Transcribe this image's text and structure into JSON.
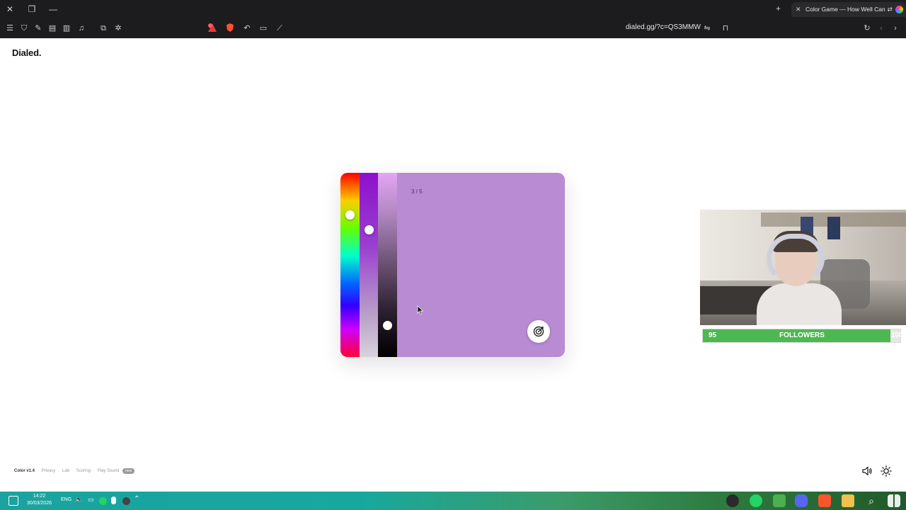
{
  "browser": {
    "tab_title": "Color Game — How Well Can",
    "url": "dialed.gg/?c=QS3MMW"
  },
  "page": {
    "logo": "Dialed."
  },
  "game": {
    "counter": "3 / 5",
    "target_color": "#b98bd3",
    "hue_level": 0.77,
    "saturation_level": 0.69,
    "lightness_level": 0.17
  },
  "overlay": {
    "followers_label": "FOLLOWERS",
    "followers_current": "95",
    "followers_goal": "100",
    "progress": 0.95
  },
  "footer": {
    "version": "Color v1.4",
    "links": [
      "Privacy",
      "Lab",
      "Scoring",
      "Play Sound"
    ],
    "badge": "new"
  },
  "taskbar": {
    "time": "14:22",
    "date": "30/03/2026",
    "language": "ENG"
  }
}
